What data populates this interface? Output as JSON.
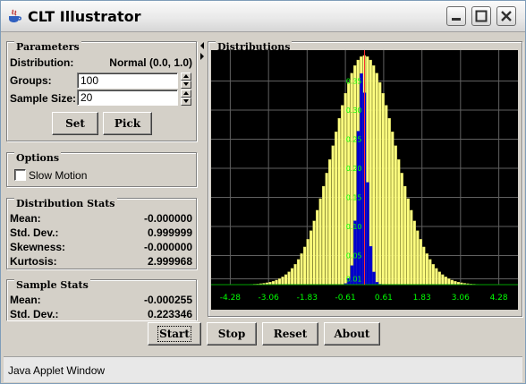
{
  "window": {
    "title": "CLT Illustrator",
    "icon": "java-cup-icon"
  },
  "parameters": {
    "title": "Parameters",
    "distribution_label": "Distribution:",
    "distribution_value": "Normal (0.0, 1.0)",
    "groups_label": "Groups:",
    "groups_value": "100",
    "sample_size_label": "Sample Size:",
    "sample_size_value": "20",
    "set_label": "Set",
    "pick_label": "Pick"
  },
  "options": {
    "title": "Options",
    "slow_motion_label": "Slow Motion",
    "slow_motion_checked": false
  },
  "distribution_stats": {
    "title": "Distribution Stats",
    "rows": [
      {
        "label": "Mean:",
        "value": "-0.000000"
      },
      {
        "label": "Std. Dev.:",
        "value": "0.999999"
      },
      {
        "label": "Skewness:",
        "value": "-0.000000"
      },
      {
        "label": "Kurtosis:",
        "value": "2.999968"
      }
    ]
  },
  "sample_stats": {
    "title": "Sample Stats",
    "rows": [
      {
        "label": "Mean:",
        "value": "-0.000255"
      },
      {
        "label": "Std. Dev.:",
        "value": "0.223346"
      }
    ]
  },
  "distributions": {
    "title": "Distributions"
  },
  "controls": {
    "start": "Start",
    "stop": "Stop",
    "reset": "Reset",
    "about": "About"
  },
  "status": {
    "text": "Java Applet Window"
  },
  "chart_data": {
    "type": "bar",
    "title": "",
    "x_ticks": [
      "-4.28",
      "-3.06",
      "-1.83",
      "-0.61",
      "0.61",
      "1.83",
      "3.06",
      "4.28"
    ],
    "y_ticks": [
      "0.01",
      "0.05",
      "0.10",
      "0.15",
      "0.20",
      "0.25",
      "0.30",
      "0.35"
    ],
    "xlim": [
      -4.89,
      4.89
    ],
    "ylim": [
      0,
      0.4
    ],
    "grid": true,
    "colors": {
      "population": "#ffff80",
      "sample_means": "#0000cc",
      "tick_text": "#00ff00",
      "axis": "#00a000",
      "mean_line": "#ff3030",
      "grid": "#606060"
    },
    "series": [
      {
        "role": "population",
        "x_start": -4.35,
        "bin_width": 0.1,
        "type": "normal",
        "mu": 0,
        "sigma": 1,
        "peak": 0.039
      },
      {
        "role": "sample_means",
        "x_start": -0.65,
        "bin_width": 0.1,
        "values": [
          0.002,
          0.01,
          0.03,
          0.1,
          0.24,
          0.33,
          0.3,
          0.16,
          0.06,
          0.02,
          0.004,
          0.001,
          0.0
        ]
      }
    ]
  }
}
